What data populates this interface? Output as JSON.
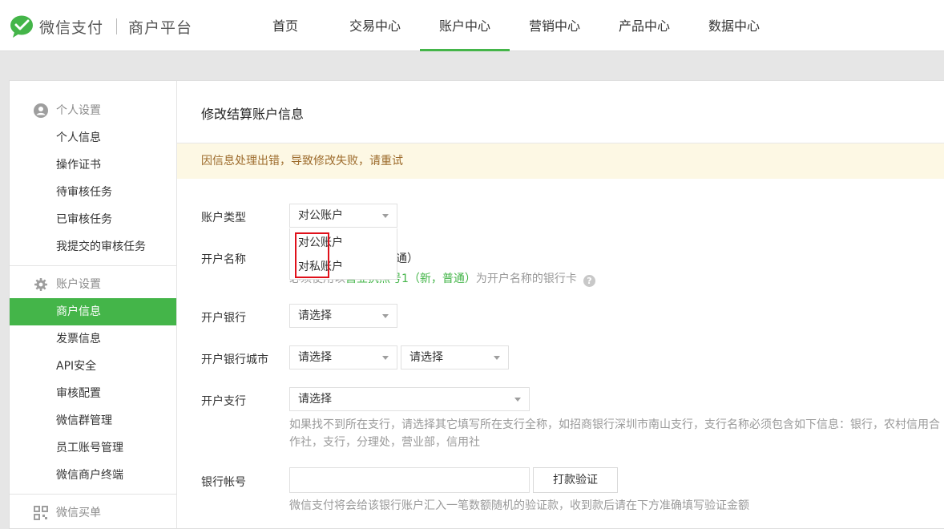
{
  "brand": {
    "name": "微信支付",
    "platform": "商户平台",
    "accent_color": "#44b549"
  },
  "nav": {
    "items": [
      {
        "label": "首页"
      },
      {
        "label": "交易中心"
      },
      {
        "label": "账户中心",
        "active": true
      },
      {
        "label": "营销中心"
      },
      {
        "label": "产品中心"
      },
      {
        "label": "数据中心"
      }
    ]
  },
  "sidebar": {
    "personal": {
      "title": "个人设置",
      "icon": "user-icon",
      "items": [
        "个人信息",
        "操作证书",
        "待审核任务",
        "已审核任务",
        "我提交的审核任务"
      ]
    },
    "account": {
      "title": "账户设置",
      "icon": "gear-icon",
      "items": [
        "商户信息",
        "发票信息",
        "API安全",
        "审核配置",
        "微信群管理",
        "员工账号管理",
        "微信商户终端"
      ],
      "active_item": "商户信息"
    },
    "next_group": {
      "title": "微信买单",
      "icon": "qrcode-icon"
    }
  },
  "content": {
    "title": "修改结算账户信息",
    "alert": "因信息处理出错，导致修改失败，请重试",
    "alert_color": "#9d6b2c",
    "form": {
      "account_type": {
        "label": "账户类型",
        "value": "对公账户",
        "options": [
          "对公账户",
          "对私账户"
        ]
      },
      "account_name": {
        "label": "开户名称",
        "value_suffix": "通）",
        "tip_prefix": "必须使用以",
        "tip_green": "营业执照号1（新，普通）",
        "tip_suffix": "为开户名称的银行卡"
      },
      "bank": {
        "label": "开户银行",
        "value": "请选择"
      },
      "bank_city": {
        "label": "开户银行城市",
        "province": "请选择",
        "city": "请选择"
      },
      "branch": {
        "label": "开户支行",
        "value": "请选择",
        "tip_line1": "如果找不到所在支行，请选择其它填写所在支行全称，如招商银行深圳市南山支行，支行名称必须包含如下信息：银行，农村信用合",
        "tip_line2": "作社，支行，分理处，营业部，信用社"
      },
      "account_number": {
        "label": "银行帐号",
        "value": "",
        "verify_button": "打款验证",
        "tip": "微信支付将会给该银行账户汇入一笔数额随机的验证款，收到款后请在下方准确填写验证金额"
      }
    }
  }
}
